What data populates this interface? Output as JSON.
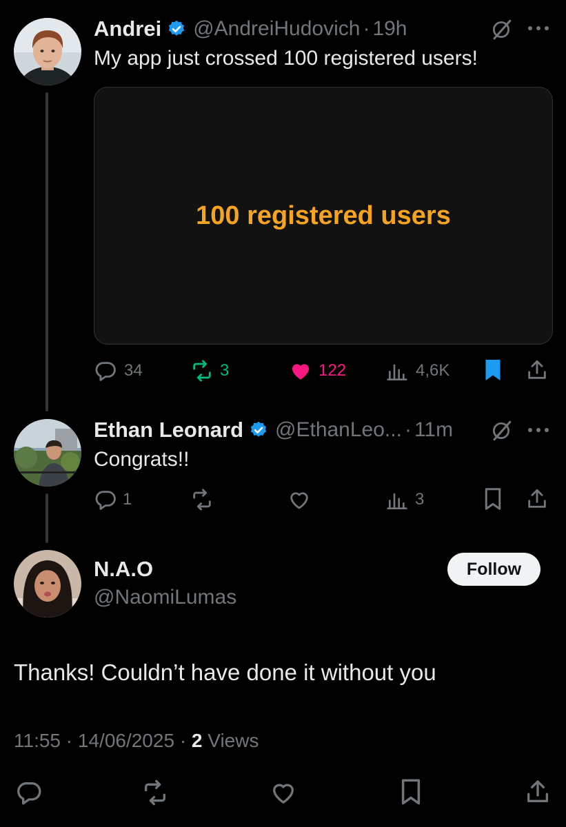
{
  "colors": {
    "background": "#000000",
    "text_primary": "#e7e9ea",
    "text_secondary": "#71767b",
    "verified_blue": "#1d9bf0",
    "retweet_green": "#00ba7c",
    "like_pink": "#f91880",
    "media_text_orange": "#f5a422"
  },
  "posts": [
    {
      "name": "Andrei",
      "handle": "@AndreiHudovich",
      "separator": "·",
      "time": "19h",
      "text": "My app just crossed 100 registered users!",
      "media_text": "100 registered users",
      "replies": "34",
      "reposts": "3",
      "likes": "122",
      "views": "4,6K",
      "verified": true,
      "bookmarked": true,
      "liked": true,
      "reposted": true
    },
    {
      "name": "Ethan Leonard",
      "handle": "@EthanLeo...",
      "separator": "·",
      "time": "11m",
      "text": "Congrats!!",
      "replies": "1",
      "views": "3",
      "verified": true
    }
  ],
  "focus_post": {
    "name": "N.A.O",
    "handle": "@NaomiLumas",
    "follow_label": "Follow",
    "text": "Thanks! Couldn’t have done it without you",
    "time": "11:55",
    "date": "14/06/2025",
    "views_count": "2",
    "views_label": "Views",
    "separator": "·"
  },
  "icons": [
    "grok-icon",
    "more-icon",
    "verified-icon",
    "reply-icon",
    "repost-icon",
    "like-icon",
    "views-icon",
    "bookmark-icon",
    "share-icon"
  ]
}
